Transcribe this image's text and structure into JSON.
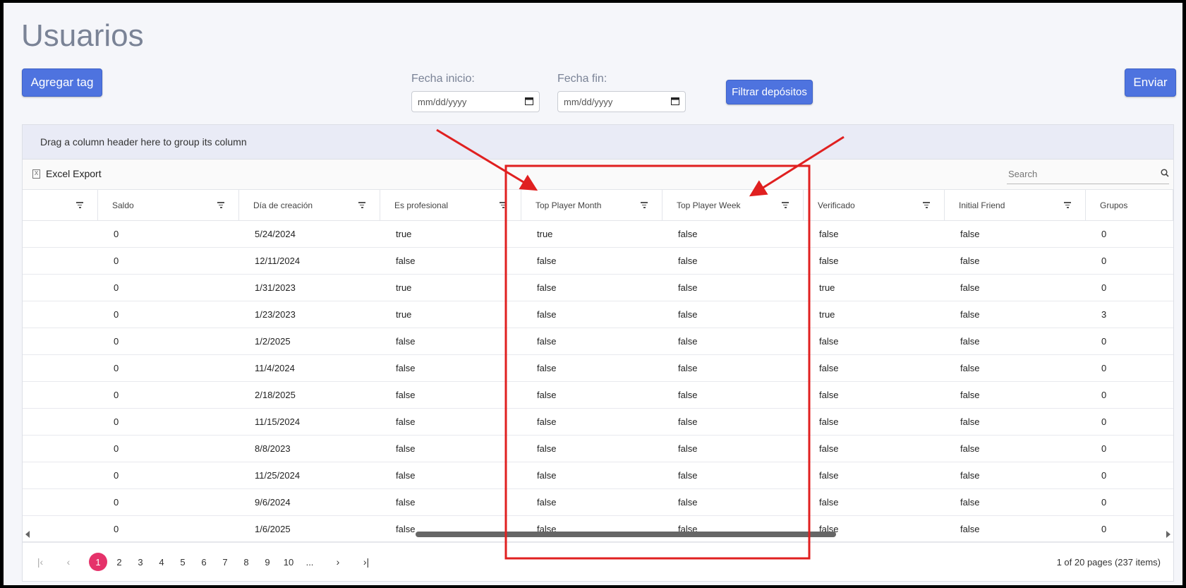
{
  "title": "Usuarios",
  "buttons": {
    "add_tag": "Agregar tag",
    "send": "Enviar",
    "filter_deposits": "Filtrar depósitos"
  },
  "dates": {
    "start_label": "Fecha inicio:",
    "end_label": "Fecha fin:",
    "placeholder": "mm/dd/yyyy"
  },
  "grid": {
    "group_panel_text": "Drag a column header here to group its column",
    "export_label": "Excel Export",
    "search_placeholder": "Search",
    "columns": [
      "",
      "Saldo",
      "Día de creación",
      "Es profesional",
      "Top Player Month",
      "Top Player Week",
      "Verificado",
      "Initial Friend",
      "Grupos"
    ],
    "rows": [
      [
        "",
        "0",
        "5/24/2024",
        "true",
        "true",
        "false",
        "false",
        "false",
        "0"
      ],
      [
        "",
        "0",
        "12/11/2024",
        "false",
        "false",
        "false",
        "false",
        "false",
        "0"
      ],
      [
        "",
        "0",
        "1/31/2023",
        "true",
        "false",
        "false",
        "true",
        "false",
        "0"
      ],
      [
        "",
        "0",
        "1/23/2023",
        "true",
        "false",
        "false",
        "true",
        "false",
        "3"
      ],
      [
        "",
        "0",
        "1/2/2025",
        "false",
        "false",
        "false",
        "false",
        "false",
        "0"
      ],
      [
        "",
        "0",
        "11/4/2024",
        "false",
        "false",
        "false",
        "false",
        "false",
        "0"
      ],
      [
        "",
        "0",
        "2/18/2025",
        "false",
        "false",
        "false",
        "false",
        "false",
        "0"
      ],
      [
        "",
        "0",
        "11/15/2024",
        "false",
        "false",
        "false",
        "false",
        "false",
        "0"
      ],
      [
        "",
        "0",
        "8/8/2023",
        "false",
        "false",
        "false",
        "false",
        "false",
        "0"
      ],
      [
        "",
        "0",
        "11/25/2024",
        "false",
        "false",
        "false",
        "false",
        "false",
        "0"
      ],
      [
        "",
        "0",
        "9/6/2024",
        "false",
        "false",
        "false",
        "false",
        "false",
        "0"
      ],
      [
        "",
        "0",
        "1/6/2025",
        "false",
        "false",
        "false",
        "false",
        "false",
        "0"
      ]
    ]
  },
  "pager": {
    "pages": [
      "1",
      "2",
      "3",
      "4",
      "5",
      "6",
      "7",
      "8",
      "9",
      "10",
      "..."
    ],
    "active_page": "1",
    "info": "1 of 20 pages (237 items)"
  },
  "colors": {
    "primary": "#4e73df",
    "active_page": "#e5326a",
    "annotation": "#e02020"
  }
}
